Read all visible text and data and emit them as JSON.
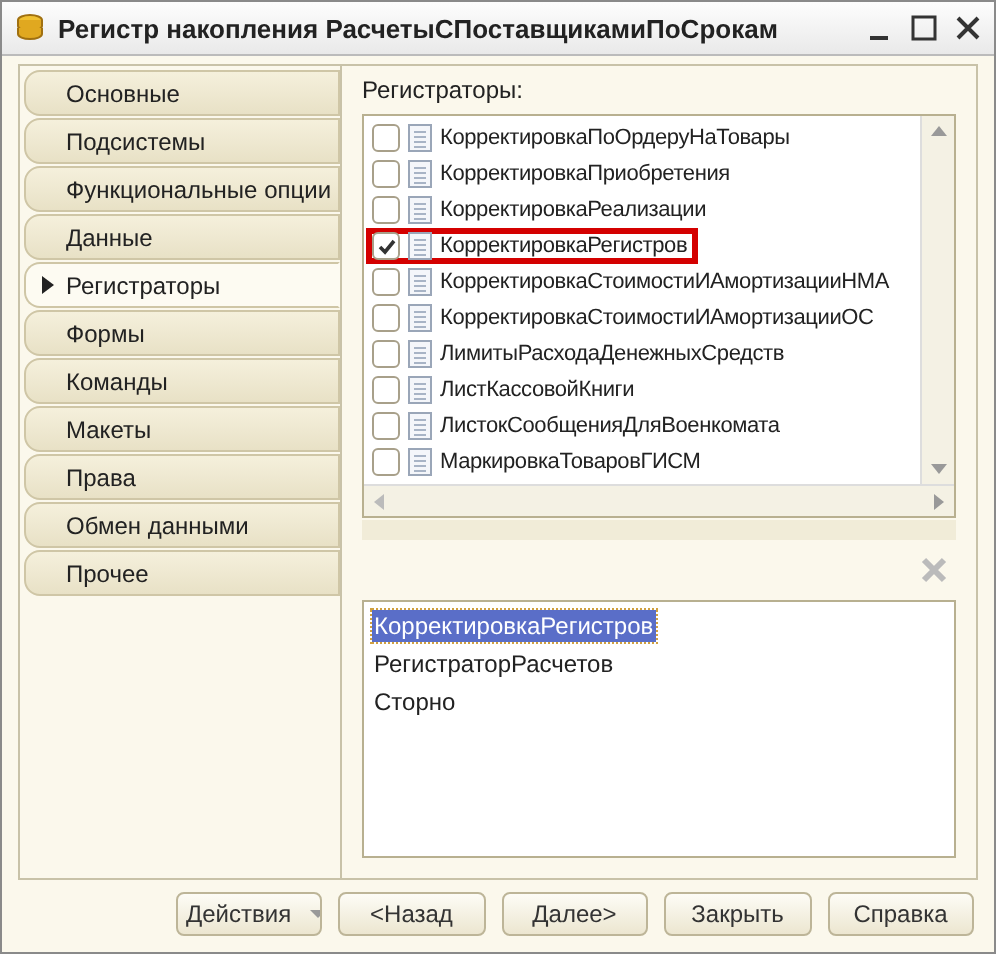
{
  "window": {
    "title": "Регистр накопления РасчетыСПоставщикамиПоСрокам"
  },
  "sidebar": {
    "items": [
      {
        "label": "Основные",
        "selected": false
      },
      {
        "label": "Подсистемы",
        "selected": false
      },
      {
        "label": "Функциональные опции",
        "selected": false
      },
      {
        "label": "Данные",
        "selected": false
      },
      {
        "label": "Регистраторы",
        "selected": true
      },
      {
        "label": "Формы",
        "selected": false
      },
      {
        "label": "Команды",
        "selected": false
      },
      {
        "label": "Макеты",
        "selected": false
      },
      {
        "label": "Права",
        "selected": false
      },
      {
        "label": "Обмен данными",
        "selected": false
      },
      {
        "label": "Прочее",
        "selected": false
      }
    ]
  },
  "registrators": {
    "label": "Регистраторы:",
    "items": [
      {
        "name": "КорректировкаПоОрдеруНаТовары",
        "checked": false,
        "highlighted": false
      },
      {
        "name": "КорректировкаПриобретения",
        "checked": false,
        "highlighted": false
      },
      {
        "name": "КорректировкаРеализации",
        "checked": false,
        "highlighted": false
      },
      {
        "name": "КорректировкаРегистров",
        "checked": true,
        "highlighted": true
      },
      {
        "name": "КорректировкаСтоимостиИАмортизацииНМА",
        "checked": false,
        "highlighted": false
      },
      {
        "name": "КорректировкаСтоимостиИАмортизацииОС",
        "checked": false,
        "highlighted": false
      },
      {
        "name": "ЛимитыРасходаДенежныхСредств",
        "checked": false,
        "highlighted": false
      },
      {
        "name": "ЛистКассовойКниги",
        "checked": false,
        "highlighted": false
      },
      {
        "name": "ЛистокСообщенияДляВоенкомата",
        "checked": false,
        "highlighted": false
      },
      {
        "name": "МаркировкаТоваровГИСМ",
        "checked": false,
        "highlighted": false
      }
    ]
  },
  "selected_list": {
    "items": [
      {
        "name": "КорректировкаРегистров",
        "selected": true
      },
      {
        "name": "РегистраторРасчетов",
        "selected": false
      },
      {
        "name": "Сторно",
        "selected": false
      }
    ]
  },
  "buttons": [
    {
      "label": "Действия",
      "kind": "dropdown"
    },
    {
      "label": "<Назад",
      "kind": "plain"
    },
    {
      "label": "Далее>",
      "kind": "plain"
    },
    {
      "label": "Закрыть",
      "kind": "plain"
    },
    {
      "label": "Справка",
      "kind": "plain"
    }
  ]
}
